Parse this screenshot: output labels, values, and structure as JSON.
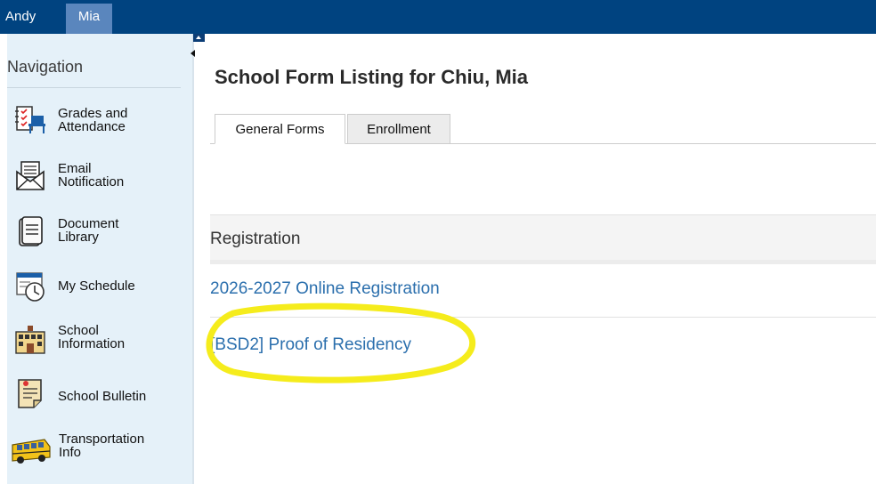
{
  "students": [
    {
      "name": "Andy",
      "selected": false
    },
    {
      "name": "Mia",
      "selected": true
    }
  ],
  "sidebar": {
    "heading": "Navigation",
    "items": [
      {
        "line1": "Grades and",
        "line2": "Attendance",
        "icon": "gradebook-icon"
      },
      {
        "line1": "Email",
        "line2": "Notification",
        "icon": "envelope-icon"
      },
      {
        "line1": "Document",
        "line2": "Library",
        "icon": "document-icon"
      },
      {
        "line1": "My Schedule",
        "line2": "",
        "icon": "schedule-clock-icon"
      },
      {
        "line1": "School",
        "line2": "Information",
        "icon": "school-building-icon"
      },
      {
        "line1": "School Bulletin",
        "line2": "",
        "icon": "bulletin-icon"
      },
      {
        "line1": "Transportation",
        "line2": "Info",
        "icon": "school-bus-icon"
      }
    ]
  },
  "main": {
    "title": "School Form Listing for Chiu, Mia",
    "tabs": [
      {
        "label": "General Forms",
        "active": true
      },
      {
        "label": "Enrollment",
        "active": false
      }
    ],
    "section": {
      "title": "Registration",
      "links": [
        {
          "label": "2026-2027 Online Registration"
        },
        {
          "label": "[BSD2] Proof of Residency"
        }
      ]
    }
  },
  "colors": {
    "topbar": "#004380",
    "selected_student": "#5a86bd",
    "sidebar_bg": "#e5f1f9",
    "link": "#2b6fad",
    "highlight": "#f5ec1c"
  }
}
